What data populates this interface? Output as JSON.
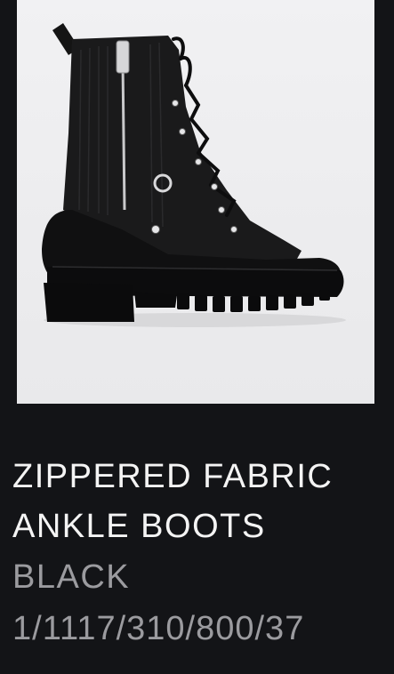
{
  "product": {
    "image_alt": "ankle-boot-photo",
    "name_line1": "ZIPPERED FABRIC",
    "name_line2": "ANKLE BOOTS",
    "color": "BLACK",
    "reference": "1/1117/310/800/37"
  },
  "colors": {
    "background": "#131417",
    "image_background": "#efeff1",
    "title_text": "#f4f4f4",
    "secondary_text": "#9b9b9f"
  }
}
